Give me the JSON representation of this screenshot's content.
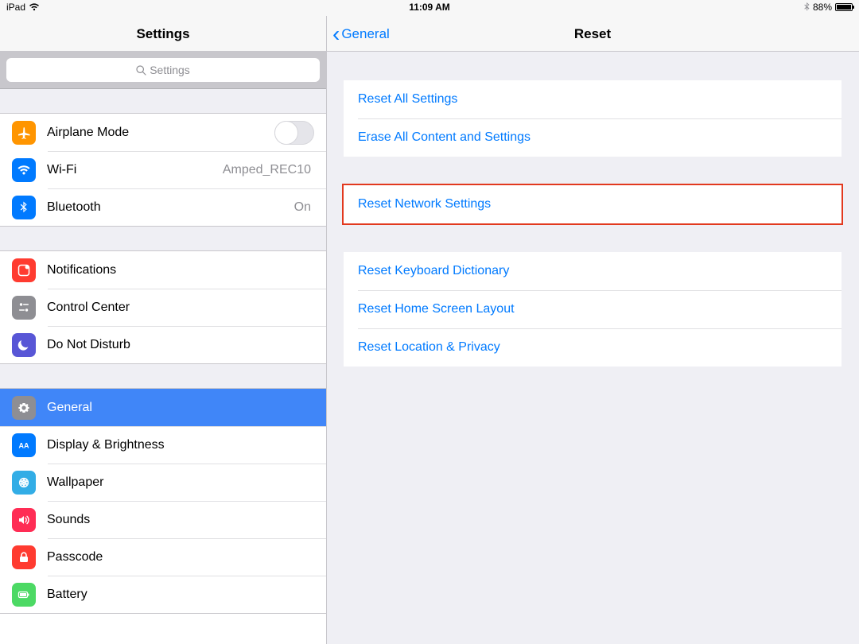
{
  "status": {
    "device": "iPad",
    "time": "11:09 AM",
    "battery_pct": "88%"
  },
  "sidebar": {
    "title": "Settings",
    "search_placeholder": "Settings",
    "groups": [
      {
        "items": [
          {
            "id": "airplane",
            "label": "Airplane Mode",
            "value": null,
            "toggle": false,
            "icon": "airplane",
            "color": "#ff9500"
          },
          {
            "id": "wifi",
            "label": "Wi-Fi",
            "value": "Amped_REC10",
            "icon": "wifi",
            "color": "#007aff"
          },
          {
            "id": "bluetooth",
            "label": "Bluetooth",
            "value": "On",
            "icon": "bluetooth",
            "color": "#007aff"
          }
        ]
      },
      {
        "items": [
          {
            "id": "notifications",
            "label": "Notifications",
            "icon": "notifications",
            "color": "#ff3b30"
          },
          {
            "id": "controlcenter",
            "label": "Control Center",
            "icon": "controlcenter",
            "color": "#8e8e93"
          },
          {
            "id": "dnd",
            "label": "Do Not Disturb",
            "icon": "moon",
            "color": "#5856d6"
          }
        ]
      },
      {
        "items": [
          {
            "id": "general",
            "label": "General",
            "icon": "gear",
            "color": "#8e8e93",
            "selected": true
          },
          {
            "id": "display",
            "label": "Display & Brightness",
            "icon": "display",
            "color": "#007aff"
          },
          {
            "id": "wallpaper",
            "label": "Wallpaper",
            "icon": "wallpaper",
            "color": "#32ade6"
          },
          {
            "id": "sounds",
            "label": "Sounds",
            "icon": "sounds",
            "color": "#ff2d55"
          },
          {
            "id": "passcode",
            "label": "Passcode",
            "icon": "passcode",
            "color": "#ff3b30"
          },
          {
            "id": "battery",
            "label": "Battery",
            "icon": "battery",
            "color": "#4cd964"
          }
        ]
      }
    ]
  },
  "detail": {
    "back_label": "General",
    "title": "Reset",
    "groups": [
      {
        "highlight": false,
        "items": [
          {
            "id": "reset-all",
            "label": "Reset All Settings"
          },
          {
            "id": "erase-all",
            "label": "Erase All Content and Settings"
          }
        ]
      },
      {
        "highlight": true,
        "items": [
          {
            "id": "reset-network",
            "label": "Reset Network Settings"
          }
        ]
      },
      {
        "highlight": false,
        "items": [
          {
            "id": "reset-keyboard",
            "label": "Reset Keyboard Dictionary"
          },
          {
            "id": "reset-home",
            "label": "Reset Home Screen Layout"
          },
          {
            "id": "reset-location",
            "label": "Reset Location & Privacy"
          }
        ]
      }
    ]
  }
}
